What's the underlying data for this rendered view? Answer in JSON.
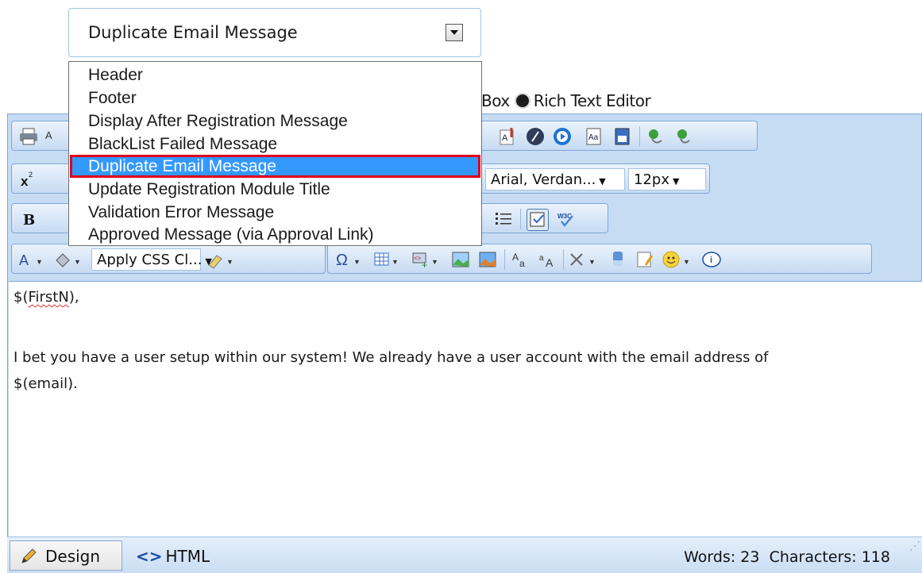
{
  "select": {
    "value": "Duplicate Email Message"
  },
  "dropdown": {
    "items": [
      "Header",
      "Footer",
      "Display After Registration Message",
      "BlackList Failed Message",
      "Duplicate Email Message",
      "Update Registration Module Title",
      "Validation Error Message",
      "Approved Message (via Approval Link)"
    ],
    "selected_index": 4
  },
  "editor_mode": {
    "partial_label": "Box",
    "rich_text_label": "Rich Text Editor"
  },
  "toolbar": {
    "font_name": "Arial, Verdan...",
    "font_size": "12px",
    "css_class": "Apply CSS Cl..."
  },
  "content": {
    "greeting_prefix": "$(",
    "greeting_var": "FirstN",
    "greeting_suffix": "),",
    "line1": "I bet you have a user setup within our system! We already have a user account with the email address of",
    "line2": "$(email)."
  },
  "bottom": {
    "design_label": "Design",
    "html_label": "HTML",
    "words": "Words: 23",
    "characters": "Characters: 118"
  },
  "colors": {
    "selection": "#3399ff",
    "highlight_border": "#e0001b",
    "toolbar_bg": "#c6dcf3"
  }
}
